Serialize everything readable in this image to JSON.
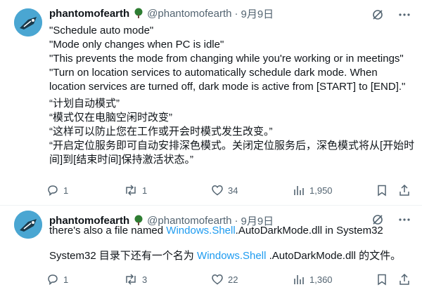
{
  "tweets": [
    {
      "name": "phantomofearth",
      "handle": "@phantomofearth",
      "sep": "·",
      "date": "9月9日",
      "lines_en": [
        "\"Schedule auto mode\"",
        "\"Mode only changes when PC is idle\"",
        "\"This prevents the mode from changing while you're working or in meetings\"",
        "\"Turn on location services to automatically schedule dark mode. When",
        "location services are turned off, dark mode is active from [START] to [END].\""
      ],
      "lines_zh": [
        "“计划自动模式”",
        "“模式仅在电脑空闲时改变”",
        "“这样可以防止您在工作或开会时模式发生改变。”",
        "“开启定位服务即可自动安排深色模式。关闭定位服务后，深色模式将从[开始时间]到[结束时间]保持激活状态。”"
      ],
      "stats": {
        "replies": "1",
        "reposts": "1",
        "likes": "34",
        "views": "1,950"
      }
    },
    {
      "name": "phantomofearth",
      "handle": "@phantomofearth",
      "sep": "·",
      "date": "9月9日",
      "text_prefix": "there's also a file named ",
      "text_link": "Windows.Shell",
      "text_suffix": ".AutoDarkMode.dll in System32",
      "zh_prefix": "System32 目录下还有一个名为 ",
      "zh_link": "Windows.Shell",
      "zh_suffix": " .AutoDarkMode.dll 的文件。",
      "stats": {
        "replies": "1",
        "reposts": "3",
        "likes": "22",
        "views": "1,360"
      }
    }
  ],
  "colors": {
    "text": "#0f1419",
    "secondary": "#536471",
    "link": "#1d9bf0",
    "avatar_bg": "#4aa6d2",
    "tree": "#2e7d32"
  },
  "icons": [
    "tree-icon",
    "grok-translate-icon",
    "more-icon",
    "reply-icon",
    "repost-icon",
    "like-icon",
    "views-icon",
    "bookmark-icon",
    "share-icon"
  ]
}
